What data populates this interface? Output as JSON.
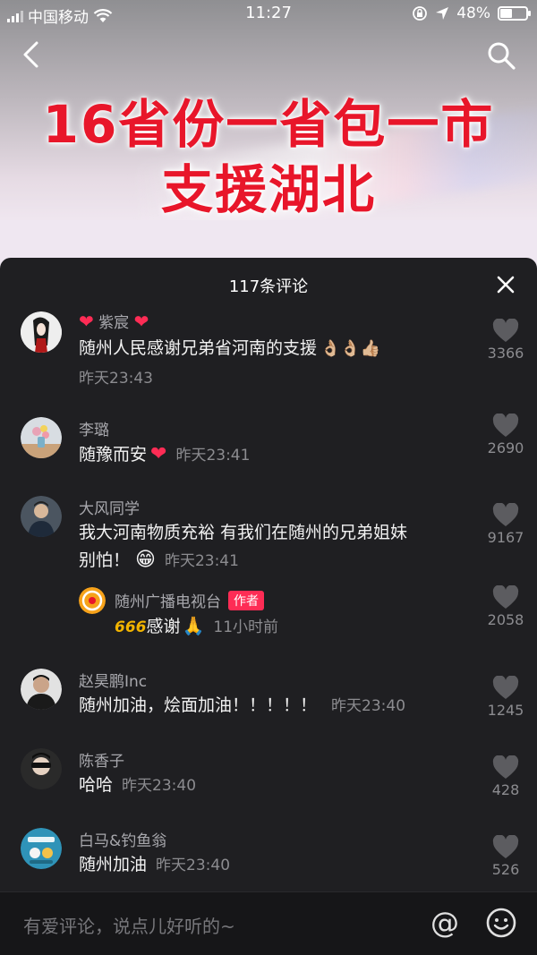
{
  "status_bar": {
    "carrier": "中国移动",
    "time": "11:27",
    "battery": "48%",
    "battery_level": 0.48
  },
  "video": {
    "headline_line1": "16省份一省包一市",
    "headline_line2": "支援湖北"
  },
  "panel": {
    "title": "117条评论"
  },
  "comments": [
    {
      "name": "紫宸",
      "text": "随州人民感谢兄弟省河南的支援",
      "emojis": "👌🏼👌🏼👍🏼",
      "time": "昨天23:43",
      "likes": "3366"
    },
    {
      "name": "李璐",
      "text": "随豫而安",
      "time": "昨天23:41",
      "likes": "2690"
    },
    {
      "name": "大风同学",
      "text_line1": "我大河南物质充裕 有我们在随州的兄弟姐妹",
      "text_line2": "别怕！",
      "time": "昨天23:41",
      "likes": "9167"
    },
    {
      "name": "随州广播电视台",
      "badge": "作者",
      "text": "感谢",
      "prefix_emoji": "666",
      "time": "11小时前",
      "likes": "2058"
    },
    {
      "name": "赵昊鹏Inc",
      "text": "随州加油，烩面加油！！！！！",
      "time": "昨天23:40",
      "likes": "1245"
    },
    {
      "name": "陈香子",
      "text": "哈哈",
      "time": "昨天23:40",
      "likes": "428"
    },
    {
      "name": "白马&钓鱼翁",
      "text": "随州加油",
      "time": "昨天23:40",
      "likes": "526"
    }
  ],
  "input": {
    "placeholder": "有爱评论，说点儿好听的~",
    "at_symbol": "@"
  },
  "colors": {
    "panel_bg": "#1f1f22",
    "accent": "#fe2c55",
    "headline_red": "#e8162a"
  },
  "icons": [
    "signal-icon",
    "wifi-icon",
    "lock-rotation-icon",
    "location-icon",
    "battery-icon",
    "back-icon",
    "search-icon",
    "close-icon",
    "heart-icon",
    "emoji-icon",
    "at-icon"
  ]
}
